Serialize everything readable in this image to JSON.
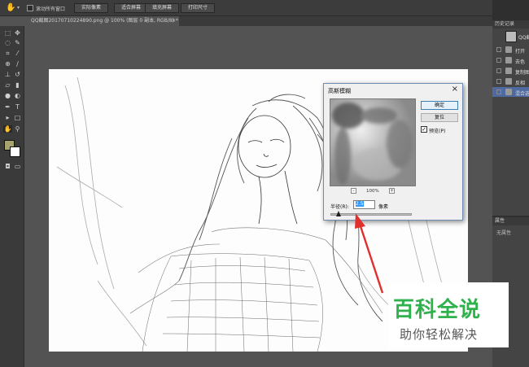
{
  "options_bar": {
    "checkbox_label": "滚动所有窗口",
    "buttons": [
      "实际像素",
      "适合屏幕",
      "填充屏幕",
      "打印尺寸"
    ]
  },
  "document_tab": {
    "title": "QQ截图20170710224890.png @ 100% (图层 0 副本, RGB/8) *",
    "close": "×"
  },
  "history_panel": {
    "title": "历史记录",
    "snapshot_label": "QQ截",
    "items": [
      "打开",
      "去色",
      "复制图",
      "反相",
      "混合选"
    ]
  },
  "properties_panel": {
    "title": "属性",
    "empty_text": "无属性"
  },
  "colors": {
    "foreground": "#a6a36f",
    "background": "#ffffff",
    "history_selected": "#4f6aa0",
    "watermark_green": "#2fb24c"
  },
  "dialog": {
    "title": "高斯模糊",
    "close": "×",
    "ok_label": "确定",
    "reset_label": "复位",
    "preview_label": "预览(P)",
    "preview_checked": "✓",
    "zoom_minus": "-",
    "zoom_plus": "+",
    "zoom_level": "100%",
    "radius_label": "半径(R):",
    "radius_value": "2.5",
    "radius_unit": "像素",
    "slider_fraction": 0.1
  },
  "watermark": {
    "title": "百科全说",
    "subtitle": "助你轻松解决"
  },
  "icons": [
    "hand-icon",
    "move-icon",
    "marquee-icon",
    "lasso-icon",
    "quick-select-icon",
    "crop-icon",
    "eyedropper-icon",
    "healing-brush-icon",
    "brush-icon",
    "clone-stamp-icon",
    "history-brush-icon",
    "eraser-icon",
    "gradient-icon",
    "blur-icon",
    "dodge-icon",
    "pen-icon",
    "type-icon",
    "path-select-icon",
    "shape-icon",
    "zoom-icon",
    "quick-mask-icon",
    "screen-mode-icon"
  ]
}
